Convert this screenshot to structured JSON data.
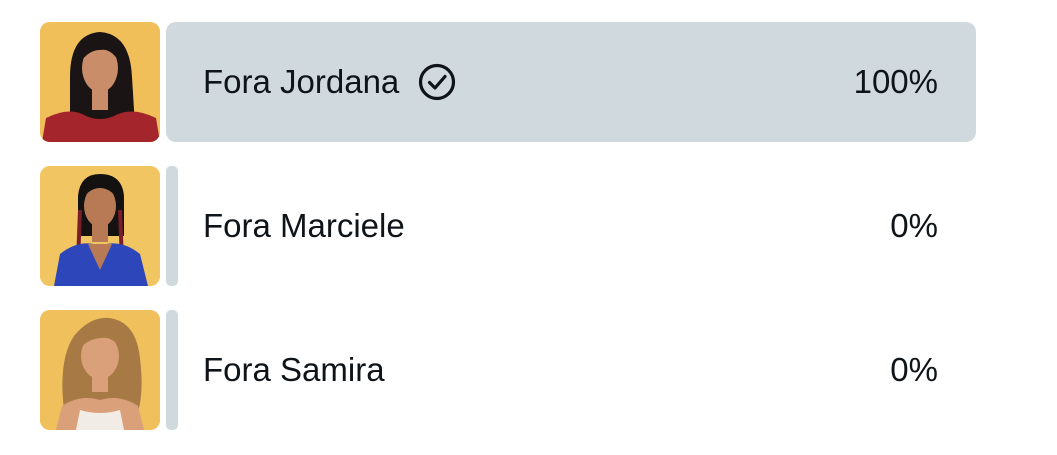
{
  "poll": {
    "options": [
      {
        "label": "Fora Jordana",
        "percent_text": "100%",
        "percent": 100,
        "selected": true,
        "check_icon": "check-circle-icon",
        "avatar": {
          "icon": "person-photo-jordana",
          "background": "#f0bf5a",
          "hair": "#1a1414",
          "skin": "#c98d6a",
          "outfit": "#a4262c"
        }
      },
      {
        "label": "Fora Marciele",
        "percent_text": "0%",
        "percent": 0,
        "selected": false,
        "avatar": {
          "icon": "person-photo-marciele",
          "background": "#f2c563",
          "hair": "#141210",
          "skin": "#b77a55",
          "outfit": "#2d46b9"
        }
      },
      {
        "label": "Fora Samira",
        "percent_text": "0%",
        "percent": 0,
        "selected": false,
        "avatar": {
          "icon": "person-photo-samira",
          "background": "#f0c05c",
          "hair": "#a77a45",
          "skin": "#d9a07a",
          "outfit": "#f2ece6"
        }
      }
    ],
    "bar_color": "#cfd9de",
    "text_color": "#0f1419"
  }
}
